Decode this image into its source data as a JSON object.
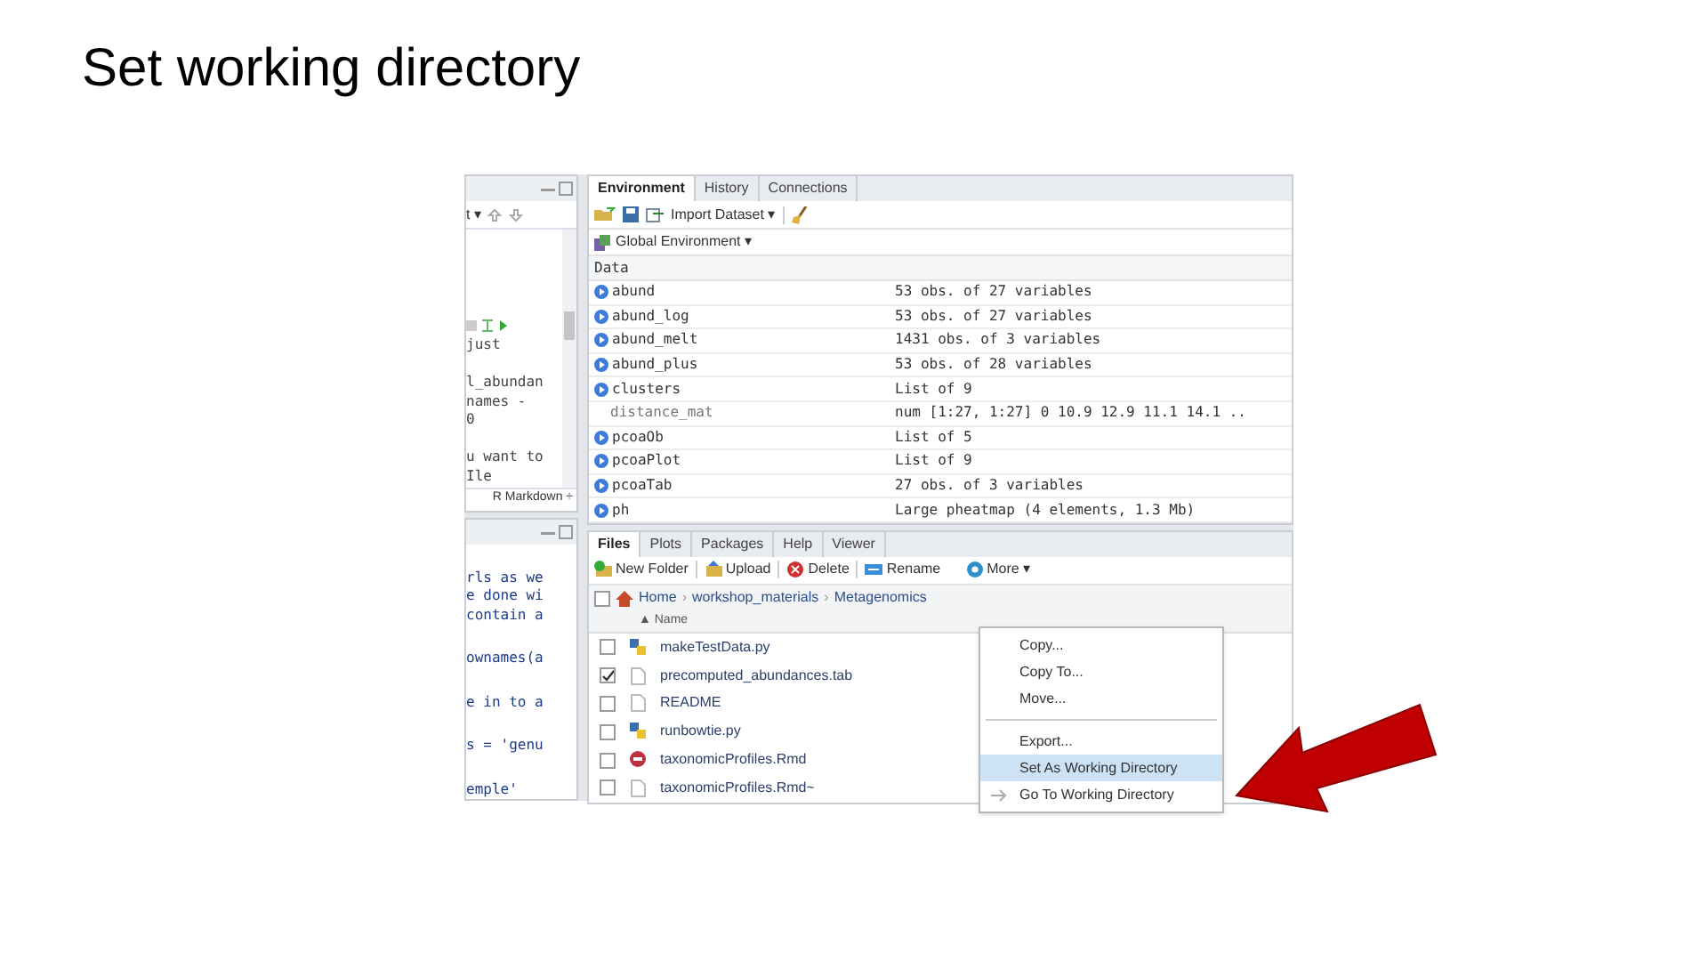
{
  "title": "Set working directory",
  "source_pane": {
    "toolbar_text": "t ▾",
    "blocks": [
      [
        "just"
      ],
      [
        "l_abundan",
        "names -",
        "0"
      ],
      [
        "u want to",
        "Ile"
      ]
    ],
    "doc_type": "R Markdown ÷"
  },
  "console_pane": {
    "blocks": [
      [
        "rls as we",
        "e done wi",
        "contain a"
      ],
      [
        "ownames(a"
      ],
      [
        "e in to a"
      ],
      [
        "s = 'genu"
      ],
      [
        "emple'"
      ]
    ]
  },
  "environment_pane": {
    "tabs": [
      {
        "label": "Environment",
        "selected": true
      },
      {
        "label": "History",
        "selected": false
      },
      {
        "label": "Connections",
        "selected": false
      }
    ],
    "import_button": "Import Dataset ▾",
    "scope": "Global Environment ▾",
    "section": "Data",
    "rows": [
      {
        "name": "abund",
        "value": "53 obs. of 27 variables",
        "children": []
      },
      {
        "name": "abund_log",
        "value": "53 obs. of 27 variables",
        "children": []
      },
      {
        "name": "abund_melt",
        "value": "1431 obs. of 3 variables",
        "children": []
      },
      {
        "name": "abund_plus",
        "value": "53 obs. of 28 variables",
        "children": []
      },
      {
        "name": "clusters",
        "value": "List of 9",
        "children": [
          {
            "name": "distance_mat",
            "value": "num [1:27, 1:27] 0 10.9 12.9 11.1 14.1 .."
          }
        ]
      },
      {
        "name": "pcoaOb",
        "value": "List of 5",
        "children": []
      },
      {
        "name": "pcoaPlot",
        "value": "List of 9",
        "children": []
      },
      {
        "name": "pcoaTab",
        "value": "27 obs. of 3 variables",
        "children": []
      },
      {
        "name": "ph",
        "value": "Large pheatmap (4 elements, 1.3 Mb)",
        "children": []
      }
    ]
  },
  "files_pane": {
    "tabs": [
      {
        "label": "Files",
        "selected": true
      },
      {
        "label": "Plots",
        "selected": false
      },
      {
        "label": "Packages",
        "selected": false
      },
      {
        "label": "Help",
        "selected": false
      },
      {
        "label": "Viewer",
        "selected": false
      }
    ],
    "toolbar": [
      {
        "kind": "newfolder",
        "label": "New Folder"
      },
      {
        "kind": "upload",
        "label": "Upload"
      },
      {
        "kind": "delete",
        "label": "Delete"
      },
      {
        "kind": "rename",
        "label": "Rename"
      },
      {
        "kind": "more",
        "label": "More ▾"
      }
    ],
    "select_all_checked": false,
    "breadcrumb": [
      "Home",
      "workshop_materials",
      "Metagenomics"
    ],
    "separator": "›",
    "column": "▲ Name",
    "files": [
      {
        "name": "makeTestData.py",
        "kind": "python",
        "checked": false
      },
      {
        "name": "precomputed_abundances.tab",
        "kind": "file",
        "checked": true
      },
      {
        "name": "README",
        "kind": "file",
        "checked": false
      },
      {
        "name": "runbowtie.py",
        "kind": "python",
        "checked": false
      },
      {
        "name": "taxonomicProfiles.Rmd",
        "kind": "rmd",
        "checked": false
      },
      {
        "name": "taxonomicProfiles.Rmd~",
        "kind": "file",
        "checked": false
      }
    ]
  },
  "more_menu": [
    {
      "kind": "item",
      "label": "Copy...",
      "selected": false
    },
    {
      "kind": "item",
      "label": "Copy To...",
      "selected": false
    },
    {
      "kind": "item",
      "label": "Move...",
      "selected": false
    },
    {
      "kind": "separator"
    },
    {
      "kind": "item",
      "label": "Export...",
      "selected": false
    },
    {
      "kind": "item",
      "label": "Set As Working Directory",
      "selected": true
    },
    {
      "kind": "goto",
      "label": "Go To Working Directory",
      "selected": false
    }
  ]
}
